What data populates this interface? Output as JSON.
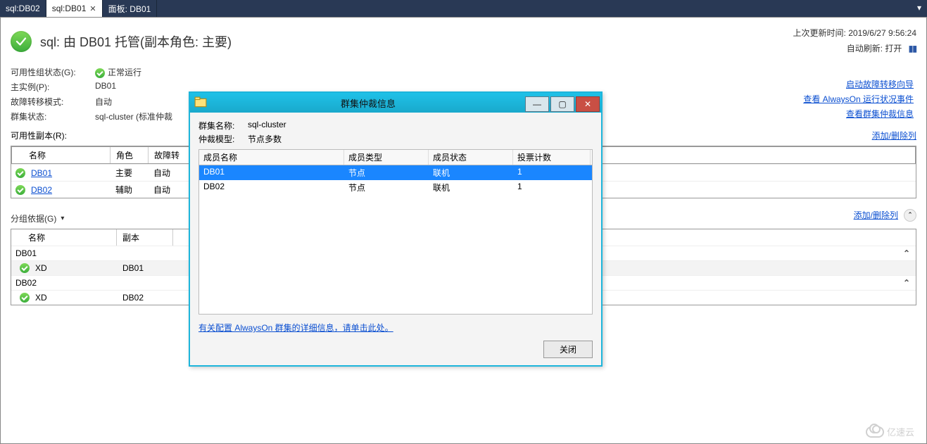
{
  "tabs": {
    "items": [
      {
        "label": "sql:DB02"
      },
      {
        "label": "sql:DB01"
      },
      {
        "label": "面板: DB01"
      }
    ],
    "activeIndex": 1
  },
  "header": {
    "title": "sql: 由 DB01 托管(副本角色: 主要)",
    "lastUpdateLabel": "上次更新时间:",
    "lastUpdateValue": "2019/6/27 9:56:24",
    "autoRefreshLabel": "自动刷新:",
    "autoRefreshValue": "打开"
  },
  "status": {
    "groupStatusLabel": "可用性组状态(G):",
    "groupStatusValue": "正常运行",
    "primaryInstanceLabel": "主实例(P):",
    "primaryInstanceValue": "DB01",
    "failoverModeLabel": "故障转移模式:",
    "failoverModeValue": "自动",
    "clusterStatusLabel": "群集状态:",
    "clusterStatusValue": "sql-cluster (标准仲裁"
  },
  "sideLinks": {
    "launchWizard": "启动故障转移向导",
    "viewEvents": "查看 AlwaysOn 运行状况事件",
    "viewQuorum": "查看群集仲裁信息"
  },
  "replicas": {
    "title": "可用性副本(R):",
    "headers": {
      "name": "名称",
      "role": "角色",
      "failover": "故障转"
    },
    "rows": [
      {
        "name": "DB01",
        "role": "主要",
        "failover": "自动"
      },
      {
        "name": "DB02",
        "role": "辅助",
        "failover": "自动"
      }
    ],
    "addRemove": "添加/删除列"
  },
  "grouping": {
    "title": "分组依据(G)",
    "headers": {
      "name": "名称",
      "replica": "副本"
    },
    "addRemove": "添加/删除列",
    "groups": [
      {
        "group": "DB01",
        "items": [
          {
            "name": "XD",
            "replica": "DB01"
          }
        ]
      },
      {
        "group": "DB02",
        "items": [
          {
            "name": "XD",
            "replica": "DB02"
          }
        ]
      }
    ]
  },
  "dialog": {
    "title": "群集仲裁信息",
    "clusterNameLabel": "群集名称:",
    "clusterNameValue": "sql-cluster",
    "quorumModelLabel": "仲裁模型:",
    "quorumModelValue": "节点多数",
    "headers": {
      "memberName": "成员名称",
      "memberType": "成员类型",
      "memberState": "成员状态",
      "voteCount": "投票计数"
    },
    "rows": [
      {
        "name": "DB01",
        "type": "节点",
        "state": "联机",
        "votes": "1"
      },
      {
        "name": "DB02",
        "type": "节点",
        "state": "联机",
        "votes": "1"
      }
    ],
    "detailsLink": "有关配置 AlwaysOn 群集的详细信息，请单击此处。",
    "closeLabel": "关闭"
  },
  "watermark": "亿速云"
}
